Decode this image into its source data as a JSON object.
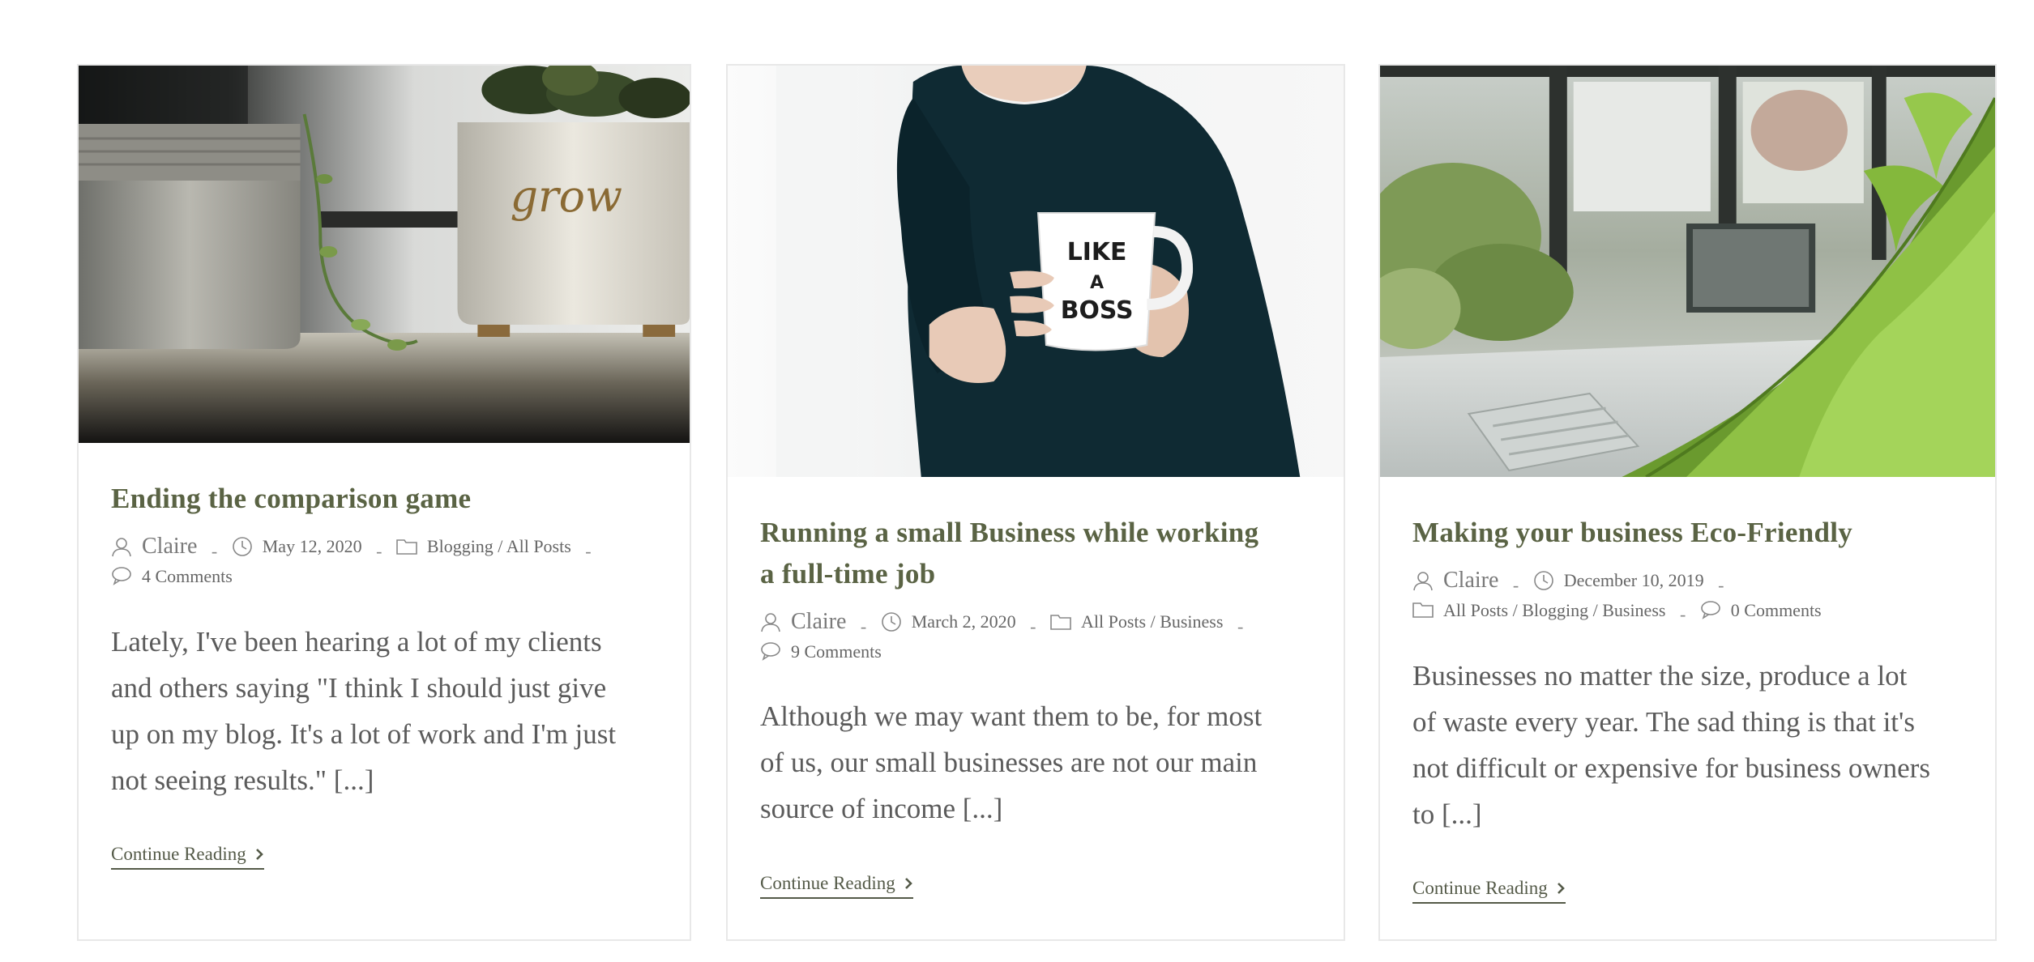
{
  "posts": [
    {
      "title": "Ending the comparison game",
      "author": "Claire",
      "date": "May 12, 2020",
      "categories": "Blogging / All Posts",
      "comments": "4 Comments",
      "excerpt_lines": [
        "Lately, I've been hearing a lot of my clients",
        "and others saying \"I think I should just give",
        "up on my blog. It's a lot of work and I'm just",
        "not seeing results.\" [...]"
      ],
      "more_label": "Continue Reading",
      "image": "potted-plants-grow-photo"
    },
    {
      "title_lines": [
        "Running a small Business while working",
        "a full-time job"
      ],
      "author": "Claire",
      "date": "March 2, 2020",
      "categories": "All Posts / Business",
      "comments": "9 Comments",
      "excerpt_lines": [
        "Although we may want them to be, for most",
        "of us, our small businesses are not our main",
        "source of income [...]"
      ],
      "more_label": "Continue Reading",
      "image": "woman-holding-mug-photo",
      "mug_text": [
        "LIKE",
        "A",
        "BOSS"
      ]
    },
    {
      "title": "Making your business Eco-Friendly",
      "author": "Claire",
      "date": "December 10, 2019",
      "categories": "All Posts / Blogging / Business",
      "comments": "0 Comments",
      "excerpt_lines": [
        "Businesses no matter the size, produce a lot",
        "of waste every year. The sad thing is that it's",
        "not difficult or expensive for business owners",
        "to [...]"
      ],
      "more_label": "Continue Reading",
      "image": "office-fern-photo"
    }
  ],
  "separator": "-",
  "colors": {
    "title": "#5a6344",
    "text": "#5b5b5b",
    "meta": "#666666",
    "border": "#e8e8e8"
  }
}
